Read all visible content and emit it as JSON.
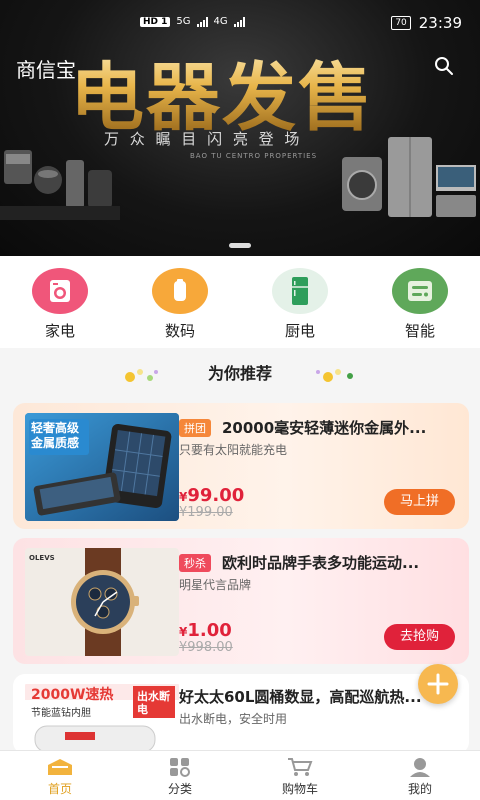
{
  "status": {
    "network": "HD 1",
    "sig1": "5G",
    "sig2": "4G",
    "battery": "70",
    "time": "23:39"
  },
  "header": {
    "app_name": "商信宝",
    "search_icon": "search-icon"
  },
  "banner": {
    "title": "电器发售",
    "subtitle": "万 众 瞩 目  闪 亮 登 场",
    "subtitle_en": "BAO TU CENTRO PROPERTIES"
  },
  "categories": [
    {
      "label": "家电",
      "icon": "washing-machine-icon",
      "color": "#f0567a"
    },
    {
      "label": "数码",
      "icon": "power-bank-icon",
      "color": "#f7a83a"
    },
    {
      "label": "厨电",
      "icon": "fridge-icon",
      "color": "#2e9e5b"
    },
    {
      "label": "智能",
      "icon": "smart-panel-icon",
      "color": "#5fa85a"
    }
  ],
  "recommend": {
    "title": "为你推荐"
  },
  "products": [
    {
      "tag": "拼团",
      "name": "20000毫安轻薄迷你金属外...",
      "desc": "只要有太阳就能充电",
      "currency": "¥",
      "price": "99.00",
      "original": "¥199.00",
      "button": "马上拼",
      "thumb_text1": "轻奢高级",
      "thumb_text2": "金属质感"
    },
    {
      "tag": "秒杀",
      "name": "欧利时品牌手表多功能运动...",
      "desc": "明星代言品牌",
      "currency": "¥",
      "price": "1.00",
      "original": "¥998.00",
      "button": "去抢购",
      "thumb_text1": "OLEVS"
    },
    {
      "name": "好太太60L圆桶数显，高配巡航热...",
      "desc": "出水断电，安全时用",
      "thumb_text1": "2000W速热",
      "thumb_text2": "节能蓝钻内胆",
      "thumb_badge": "出水断电"
    }
  ],
  "nav": [
    {
      "label": "首页",
      "icon": "home-icon",
      "active": true
    },
    {
      "label": "分类",
      "icon": "category-icon",
      "active": false
    },
    {
      "label": "购物车",
      "icon": "cart-icon",
      "active": false
    },
    {
      "label": "我的",
      "icon": "profile-icon",
      "active": false
    }
  ],
  "colors": {
    "accent": "#e0a020",
    "price_red": "#e0223a",
    "tag_orange": "#f5873a",
    "tag_red": "#ef4a5c"
  }
}
